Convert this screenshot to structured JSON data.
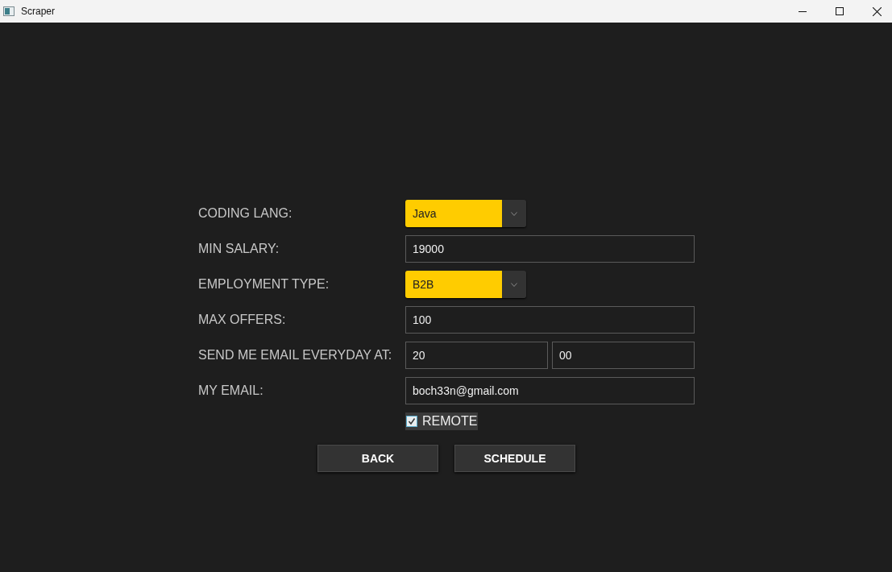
{
  "window": {
    "title": "Scraper"
  },
  "rows": [
    {
      "kind": "dropdown",
      "label": "CODING LANG:",
      "value": "Java"
    },
    {
      "kind": "text",
      "label": "MIN SALARY:",
      "value": "19000"
    },
    {
      "kind": "dropdown",
      "label": "EMPLOYMENT TYPE:",
      "value": "B2B"
    },
    {
      "kind": "text",
      "label": "MAX OFFERS:",
      "value": "100"
    },
    {
      "kind": "time",
      "label": "SEND ME EMAIL EVERYDAY AT:",
      "hours": "20",
      "minutes": "00"
    },
    {
      "kind": "text",
      "label": "MY EMAIL:",
      "value": "boch33n@gmail.com"
    }
  ],
  "remote": {
    "label": "REMOTE",
    "checked": true
  },
  "buttons": [
    "BACK",
    "SCHEDULE"
  ]
}
